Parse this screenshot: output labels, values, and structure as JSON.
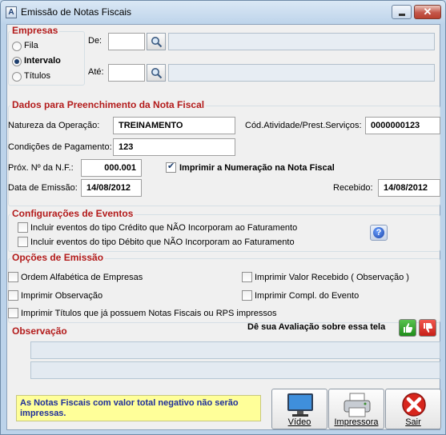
{
  "window": {
    "title": "Emissão de Notas Fiscais"
  },
  "empresas": {
    "legend": "Empresas",
    "options": [
      "Fila",
      "Intervalo",
      "Títulos"
    ],
    "selected": "Intervalo",
    "de_label": "De:",
    "ate_label": "Até:",
    "de_code": "",
    "de_name": "",
    "ate_code": "",
    "ate_name": ""
  },
  "dados": {
    "legend": "Dados para Preenchimento da Nota Fiscal",
    "natureza_label": "Natureza da Operação:",
    "natureza_value": "TREINAMENTO",
    "cod_atividade_label": "Cód.Atividade/Prest.Serviços:",
    "cod_atividade_value": "0000000123",
    "condicoes_label": "Condições de Pagamento:",
    "condicoes_value": "123",
    "prox_nf_label": "Próx. Nº da N.F.:",
    "prox_nf_value": "000.001",
    "imprimir_numeracao_label": "Imprimir a Numeração na Nota Fiscal",
    "imprimir_numeracao_checked": true,
    "data_emissao_label": "Data de Emissão:",
    "data_emissao_value": "14/08/2012",
    "recebido_label": "Recebido:",
    "recebido_value": "14/08/2012"
  },
  "eventos": {
    "legend": "Configurações de Eventos",
    "credito_label": "Incluir eventos do tipo Crédito que NÃO Incorporam ao Faturamento",
    "debito_label": "Incluir eventos do tipo Débito que NÃO Incorporam ao Faturamento",
    "help_icon": "help-icon",
    "help_glyph": "?"
  },
  "opcoes": {
    "legend": "Opções de Emissão",
    "ordem_alfabetica": "Ordem Alfabética de Empresas",
    "imprimir_valor_recebido": "Imprimir Valor Recebido ( Observação )",
    "imprimir_observacao": "Imprimir Observação",
    "imprimir_compl_evento": "Imprimir Compl. do Evento",
    "imprimir_titulos": "Imprimir Títulos que já possuem Notas Fiscais ou RPS impressos",
    "observacao_label": "Observação",
    "avaliacao_label": "Dê sua Avaliação sobre essa tela",
    "observacao_line1": "",
    "observacao_line2": ""
  },
  "footer": {
    "note": "As Notas Fiscais com valor total negativo não serão impressas.",
    "video_label": "Vídeo",
    "impressora_label": "Impressora",
    "sair_label": "Sair"
  },
  "colors": {
    "legend_red": "#b31b1b",
    "note_bg": "#ffff99",
    "note_text": "#1f2f9a",
    "window_frame": "#bcd3ea"
  }
}
